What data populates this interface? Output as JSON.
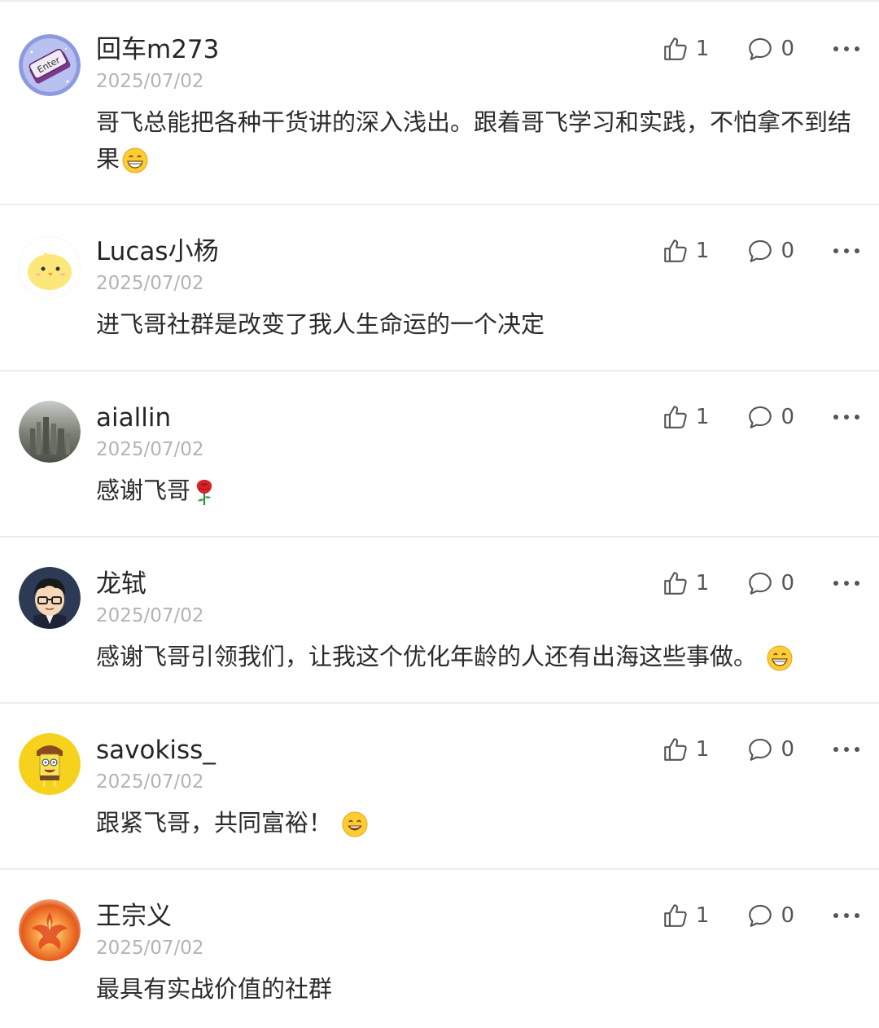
{
  "comments": [
    {
      "username": "回车m273",
      "date": "2025/07/02",
      "text": "哥飞总能把各种干货讲的深入浅出。跟着哥飞学习和实践，不怕拿不到结果",
      "emoji": "grin-emoji",
      "likes": "1",
      "replies": "0",
      "avatar": "enter-key-avatar"
    },
    {
      "username": "Lucas小杨",
      "date": "2025/07/02",
      "text": "进飞哥社群是改变了我人生命运的一个决定",
      "emoji": "",
      "likes": "1",
      "replies": "0",
      "avatar": "yellow-chick-avatar"
    },
    {
      "username": "aiallin",
      "date": "2025/07/02",
      "text": "感谢飞哥",
      "emoji": "rose-emoji",
      "likes": "1",
      "replies": "0",
      "avatar": "city-aerial-avatar"
    },
    {
      "username": "龙轼",
      "date": "2025/07/02",
      "text": "感谢飞哥引领我们，让我这个优化年龄的人还有出海这些事做。",
      "emoji": "grin-emoji",
      "likes": "1",
      "replies": "0",
      "avatar": "cartoon-glasses-avatar"
    },
    {
      "username": "savokiss_",
      "date": "2025/07/02",
      "text": "跟紧飞哥，共同富裕！",
      "emoji": "smile-emoji",
      "likes": "1",
      "replies": "0",
      "avatar": "sponge-character-avatar"
    },
    {
      "username": "王宗义",
      "date": "2025/07/02",
      "text": "最具有实战价值的社群",
      "emoji": "",
      "likes": "1",
      "replies": "0",
      "avatar": "phoenix-fire-avatar"
    }
  ],
  "colors": {
    "divider": "#ececec",
    "username": "#252525",
    "date": "#b3b3b3",
    "icon": "#555555",
    "emoji_yellow": "#ffcc33",
    "rose_red": "#d8232a"
  }
}
